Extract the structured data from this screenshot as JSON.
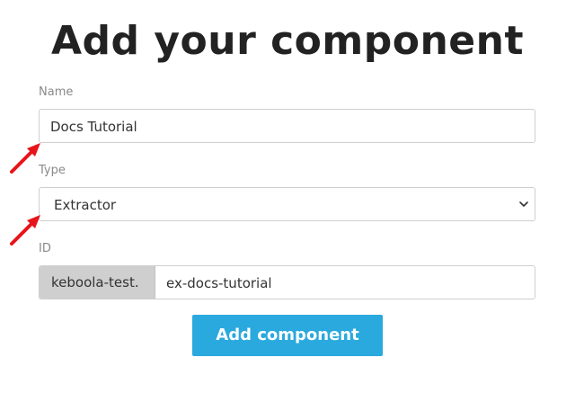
{
  "title": "Add your component",
  "name_field": {
    "label": "Name",
    "value": "Docs Tutorial"
  },
  "type_field": {
    "label": "Type",
    "selected": "Extractor"
  },
  "id_field": {
    "label": "ID",
    "prefix": "keboola-test.",
    "value": "ex-docs-tutorial"
  },
  "submit": {
    "label": "Add component"
  },
  "colors": {
    "button": "#2aa9de",
    "arrow": "#e8141b",
    "prefix_bg": "#cfcfcf"
  },
  "icons": {
    "select_indicator": "chevron-down-icon",
    "annotation": "red-arrow-icon"
  }
}
